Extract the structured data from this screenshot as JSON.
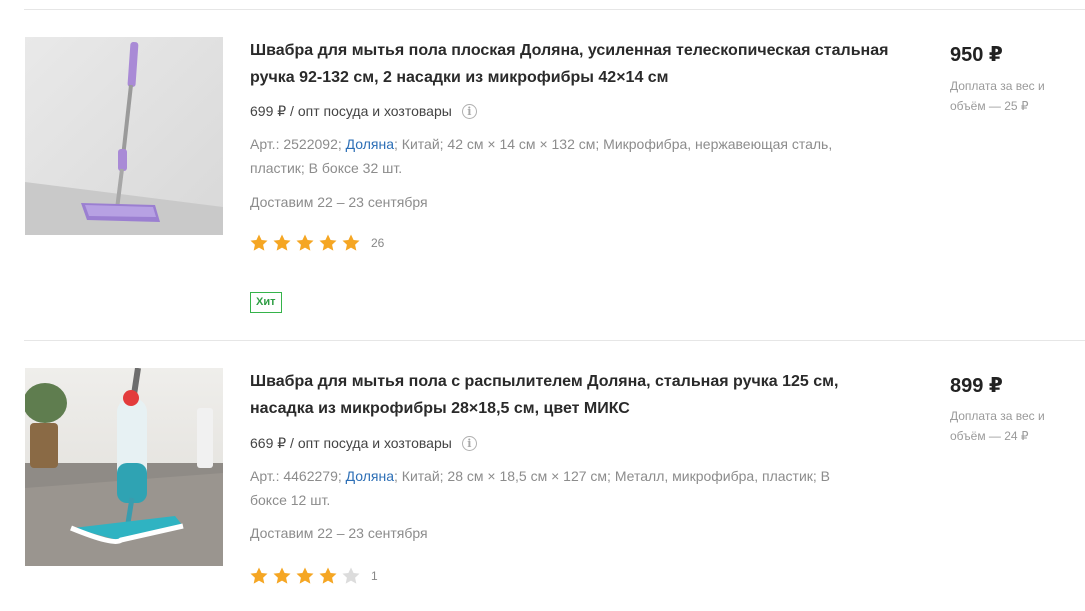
{
  "products": [
    {
      "title": "Швабра для мытья пола плоская Доляна, усиленная телескопическая стальная ручка 92-132 см, 2 насадки из микрофибры 42×14 см",
      "opt_price": "699 ₽ / опт посуда и хозтовары",
      "sku": "Арт.: 2522092;",
      "brand": "Доляна",
      "specs_rest": "; Китай; 42 см × 14 см × 132 см; Микрофибра, нержавеющая сталь, пластик; В боксе 32 шт.",
      "delivery": "Доставим 22 – 23 сентября",
      "rating": 5,
      "review_count": "26",
      "badge": "Хит",
      "price": "950 ₽",
      "surcharge": "Доплата за вес и объём — 25 ₽",
      "image_icon": "flat-mop-photo"
    },
    {
      "title": "Швабра для мытья пола с распылителем Доляна, стальная ручка 125 см, насадка из микрофибры 28×18,5 см, цвет МИКС",
      "opt_price": "669 ₽ / опт посуда и хозтовары",
      "sku": "Арт.: 4462279;",
      "brand": "Доляна",
      "specs_rest": "; Китай; 28 см × 18,5 см × 127 см; Металл, микрофибра, пластик; В боксе 12 шт.",
      "delivery": "Доставим 22 – 23 сентября",
      "rating": 4,
      "review_count": "1",
      "price": "899 ₽",
      "surcharge": "Доплата за вес и объём — 24 ₽",
      "image_icon": "spray-mop-photo"
    }
  ],
  "colors": {
    "star_filled": "#f5a623",
    "star_empty": "#dcdcdc",
    "badge": "#35b34a",
    "brand_link": "#2d6fb6"
  }
}
